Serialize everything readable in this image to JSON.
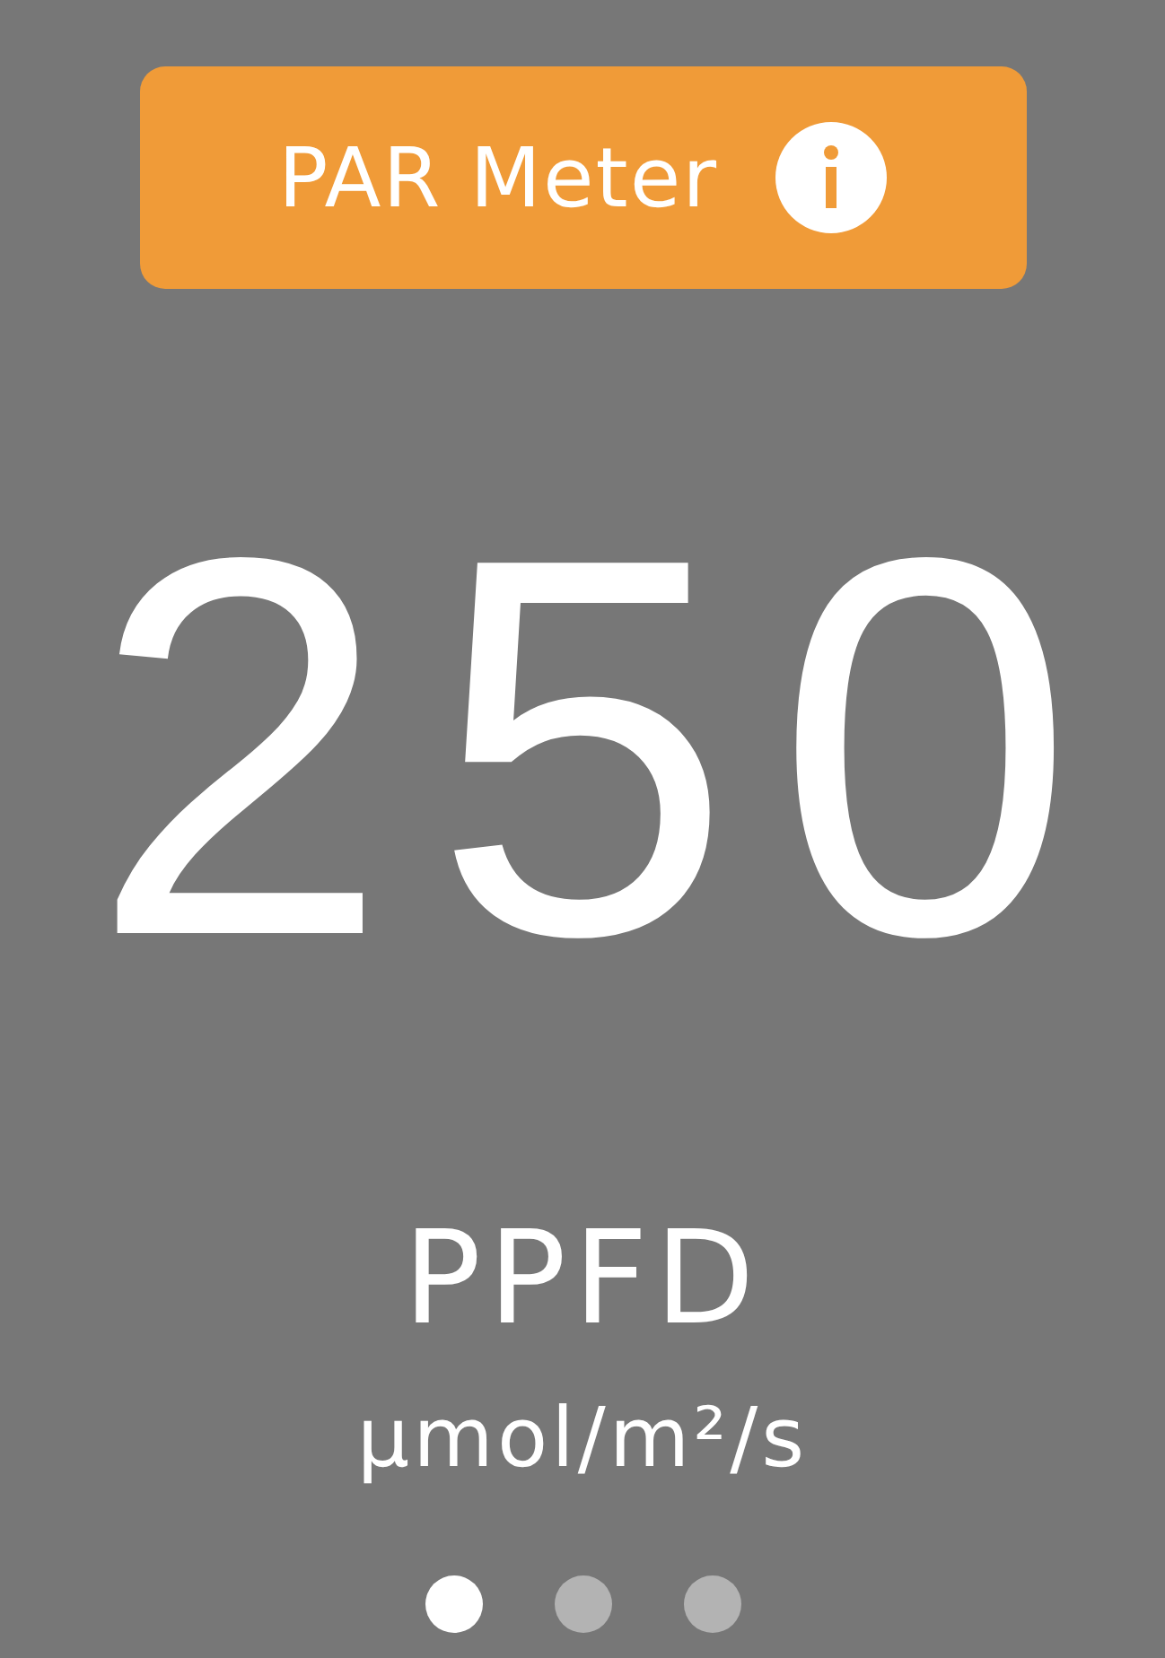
{
  "header": {
    "title": "PAR Meter"
  },
  "reading": {
    "value": "250",
    "quantity": "PPFD",
    "unit": "µmol/m²/s"
  },
  "pages": [
    {
      "selected": true
    },
    {
      "selected": false
    },
    {
      "selected": false
    }
  ]
}
